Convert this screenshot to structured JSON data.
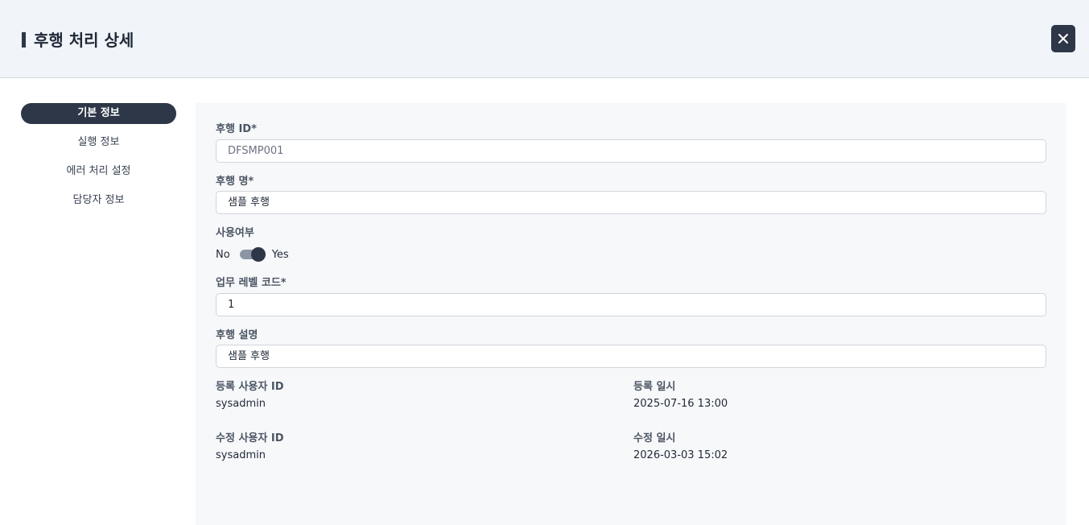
{
  "header": {
    "title": "후행 처리 상세"
  },
  "sidebar": {
    "items": [
      {
        "label": "기본 정보"
      },
      {
        "label": "실행 정보"
      },
      {
        "label": "에러 처리 설정"
      },
      {
        "label": "담당자 정보"
      }
    ]
  },
  "form": {
    "id_label": "후행 ID*",
    "id_value": "DFSMP001",
    "name_label": "후행 명*",
    "name_value": "샘플 후행",
    "use_label": "사용여부",
    "toggle_no": "No",
    "toggle_yes": "Yes",
    "toggle_state": "Yes",
    "level_label": "업무 레벨 코드*",
    "level_value": "1",
    "desc_label": "후행 설명",
    "desc_value": "샘플 후행",
    "reg_user_label": "등록 사용자 ID",
    "reg_user_value": "sysadmin",
    "reg_date_label": "등록 일시",
    "reg_date_value": "2025-07-16 13:00",
    "mod_user_label": "수정 사용자 ID",
    "mod_user_value": "sysadmin",
    "mod_date_label": "수정 일시",
    "mod_date_value": "2026-03-03 15:02"
  },
  "icons": {
    "close": "close-icon"
  }
}
